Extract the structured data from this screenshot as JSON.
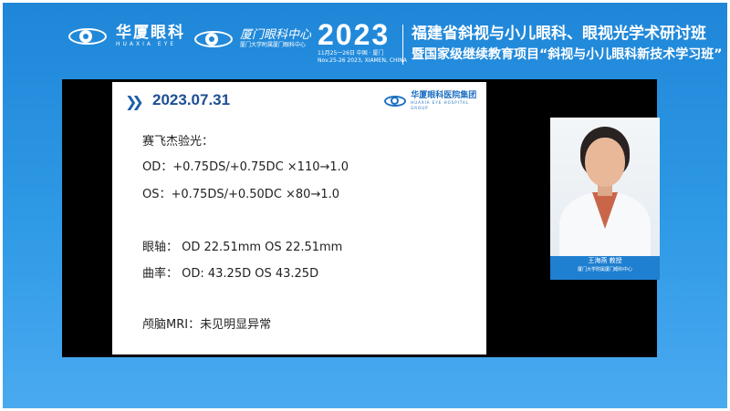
{
  "header": {
    "logo1": {
      "name_cn": "华厦眼科",
      "name_en": "HUAXIA EYE"
    },
    "logo2": {
      "name_cn": "厦门眼科中心",
      "sub": "厦门大学附属厦门眼科中心"
    },
    "year": "2023",
    "date_cn": "11月25一26日 中国 · 厦门",
    "date_en": "Nov.25-26 2023, XIAMEN, CHINA",
    "title_line1": "福建省斜视与小儿眼科、眼视光学术研讨班",
    "title_line2": "暨国家级继续教育项目“斜视与小儿眼科新技术学习班”"
  },
  "slide": {
    "chevrons": "❯❯",
    "date": "2023.07.31",
    "logo_cn": "华厦眼科医院集团",
    "logo_en": "HUAXIA EYE HOSPITAL GROUP",
    "lines": [
      "赛飞杰验光：",
      "OD：+0.75DS/+0.75DC ×110→1.0",
      "OS：+0.75DS/+0.50DC ×80→1.0",
      "眼轴：  OD 22.51mm OS 22.51mm",
      "曲率：  OD: 43.25D   OS 43.25D",
      "颅脑MRI：未见明显异常"
    ]
  },
  "speaker": {
    "name": "王海燕    教授",
    "affiliation": "厦门大学附属厦门眼科中心"
  },
  "colors": {
    "header_blue": "#1f86d8",
    "slide_date_blue": "#1c4e94",
    "nameplate_blue": "#1f7fd0"
  }
}
